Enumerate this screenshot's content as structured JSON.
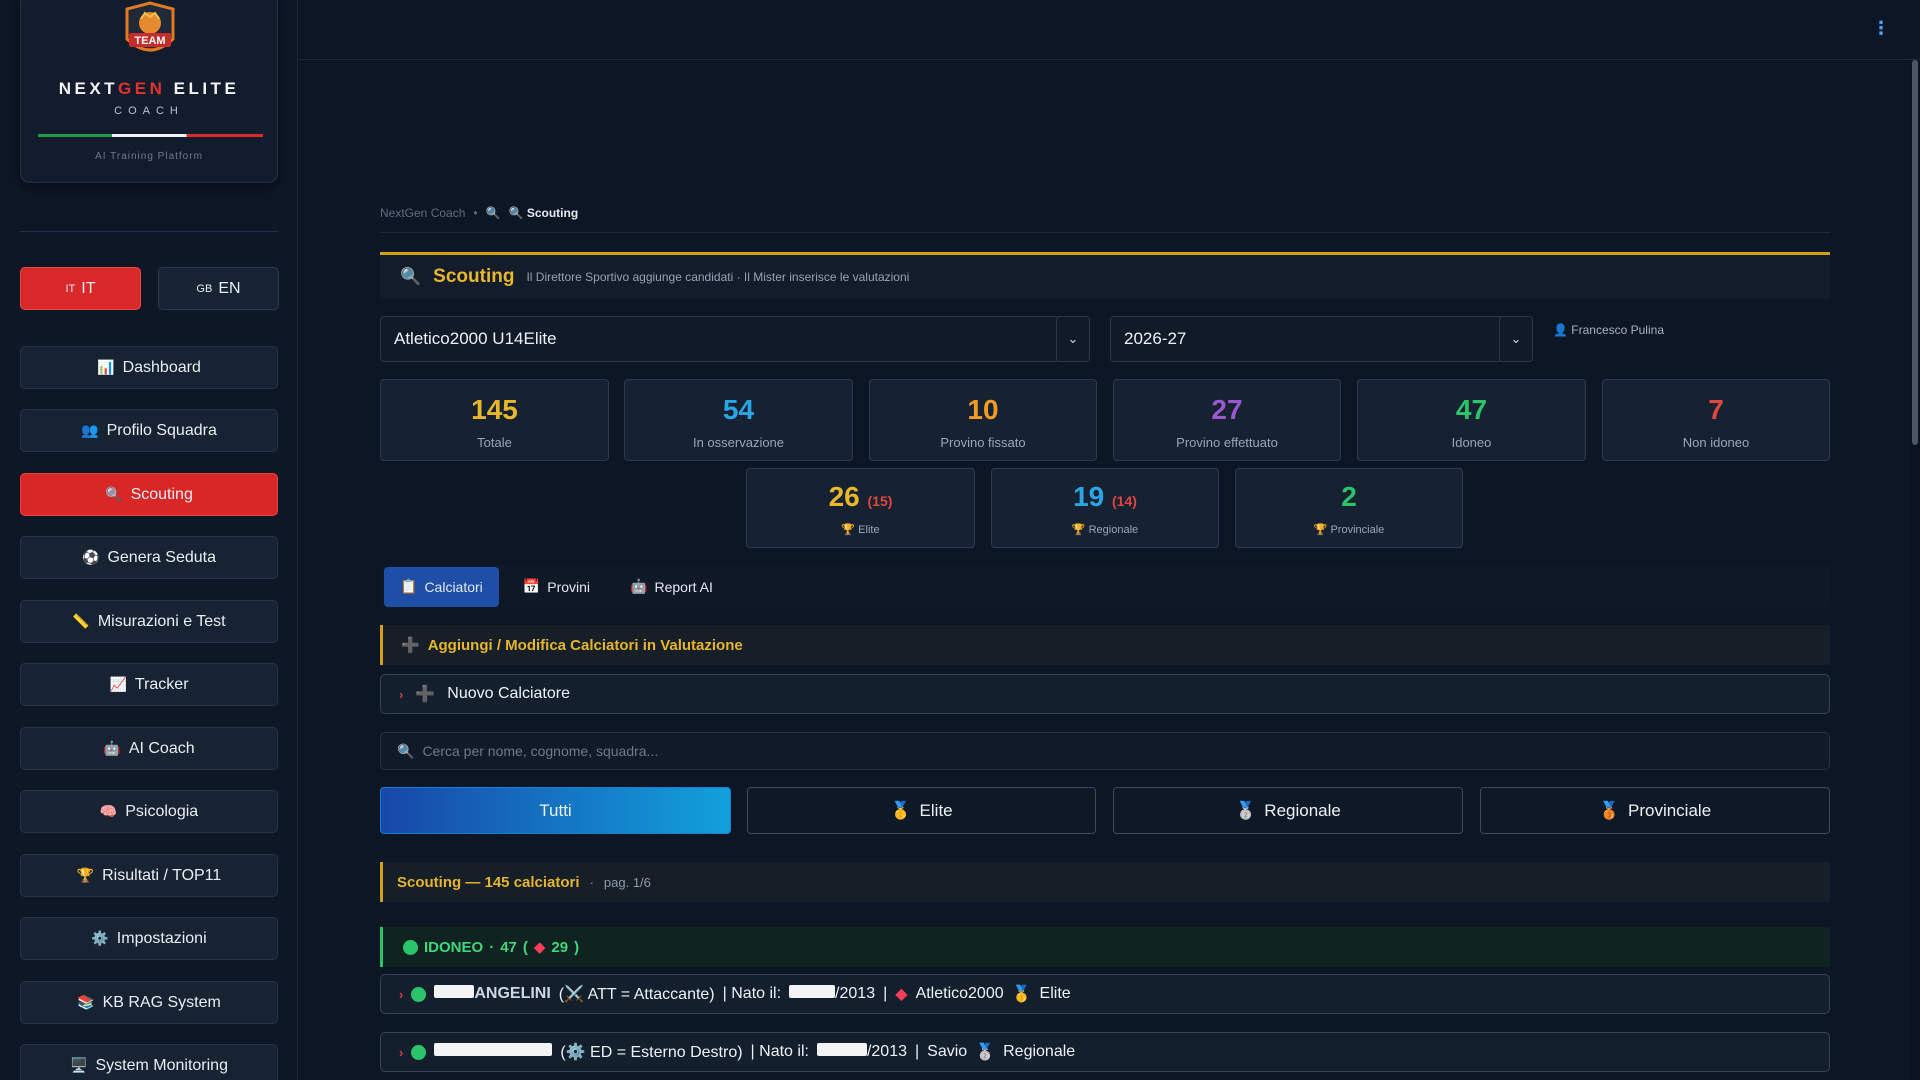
{
  "brand": {
    "badge_text": "TEAM",
    "title_pre": "NEXT",
    "title_gen": "GEN",
    "title_post": " ELITE",
    "subtitle": "COACH",
    "tagline": "AI Training Platform"
  },
  "language": {
    "it": {
      "flag": "IT",
      "label": "IT"
    },
    "en": {
      "flag": "GB",
      "label": "EN"
    }
  },
  "nav": [
    {
      "icon": "📊",
      "label": "Dashboard"
    },
    {
      "icon": "👥",
      "label": "Profilo Squadra"
    },
    {
      "icon": "🔍",
      "label": "Scouting"
    },
    {
      "icon": "⚽",
      "label": "Genera Seduta"
    },
    {
      "icon": "📏",
      "label": "Misurazioni e Test"
    },
    {
      "icon": "📈",
      "label": "Tracker"
    },
    {
      "icon": "🤖",
      "label": "AI Coach"
    },
    {
      "icon": "🧠",
      "label": "Psicologia"
    },
    {
      "icon": "🏆",
      "label": "Risultati / TOP11"
    },
    {
      "icon": "⚙️",
      "label": "Impostazioni"
    },
    {
      "icon": "📚",
      "label": "KB RAG System"
    },
    {
      "icon": "🖥️",
      "label": "System Monitoring"
    }
  ],
  "breadcrumb": {
    "root": "NextGen Coach",
    "sep": "•",
    "icon": "🔍",
    "current": "🔍 Scouting"
  },
  "header": {
    "icon": "🔍",
    "title": "Scouting",
    "description": "Il Direttore Sportivo aggiunge candidati · Il Mister inserisce le valutazioni"
  },
  "selects": {
    "team": "Atletico2000 U14Elite",
    "season": "2026-27",
    "user": "👤 Francesco Pulina"
  },
  "stats": [
    {
      "value": "145",
      "label": "Totale",
      "color": "#e8b72a"
    },
    {
      "value": "54",
      "label": "In osservazione",
      "color": "#2aa6e6"
    },
    {
      "value": "10",
      "label": "Provino fissato",
      "color": "#f39c23"
    },
    {
      "value": "27",
      "label": "Provino effettuato",
      "color": "#9b59d0"
    },
    {
      "value": "47",
      "label": "Idoneo",
      "color": "#2cc46a"
    },
    {
      "value": "7",
      "label": "Non idoneo",
      "color": "#e0473f"
    }
  ],
  "category_stats": [
    {
      "value": "26",
      "sub": "(15)",
      "label": "🏆 Elite",
      "color": "#e8b72a"
    },
    {
      "value": "19",
      "sub": "(14)",
      "label": "🏆 Regionale",
      "color": "#2aa6e6"
    },
    {
      "value": "2",
      "sub": "",
      "label": "🏆 Provinciale",
      "color": "#2cc46a"
    }
  ],
  "tabs": [
    {
      "icon": "📋",
      "label": "Calciatori"
    },
    {
      "icon": "📅",
      "label": "Provini"
    },
    {
      "icon": "🤖",
      "label": "Report AI"
    }
  ],
  "add_section": {
    "icon": "➕",
    "label": "Aggiungi / Modifica Calciatori in Valutazione"
  },
  "new_player": {
    "chevron": "›",
    "icon": "➕",
    "label": "Nuovo Calciatore"
  },
  "search": {
    "placeholder": "Cerca per nome, cognome, squadra..."
  },
  "filters": [
    {
      "icon": "",
      "label": "Tutti"
    },
    {
      "icon": "🥇",
      "label": "Elite"
    },
    {
      "icon": "🥈",
      "label": "Regionale"
    },
    {
      "icon": "🥉",
      "label": "Provinciale"
    }
  ],
  "list": {
    "title": "Scouting — 145 calciatori",
    "sep": "·",
    "page": "pag. 1/6"
  },
  "group": {
    "label": "IDONEO",
    "sep": "·",
    "count": "47",
    "elite_count": "29"
  },
  "players": [
    {
      "name_visible": "ANGELINI",
      "role": "(⚔️ ATT = Attaccante)",
      "born_prefix": "| Nato il:",
      "born_year": "/2013",
      "club_sep": "|",
      "club": "Atletico2000",
      "category_icon": "🥇",
      "category": "Elite"
    },
    {
      "name_visible": "",
      "role": "(⚙️ ED = Esterno Destro)",
      "born_prefix": "| Nato il:",
      "born_year": "/2013",
      "club_sep": "|",
      "club": "Savio",
      "category_icon": "🥈",
      "category": "Regionale"
    }
  ],
  "colors": {
    "accent_red": "#d92626",
    "accent_gold": "#e5b52b",
    "accent_green": "#2cc46a",
    "accent_blue": "#1e4ea6"
  }
}
